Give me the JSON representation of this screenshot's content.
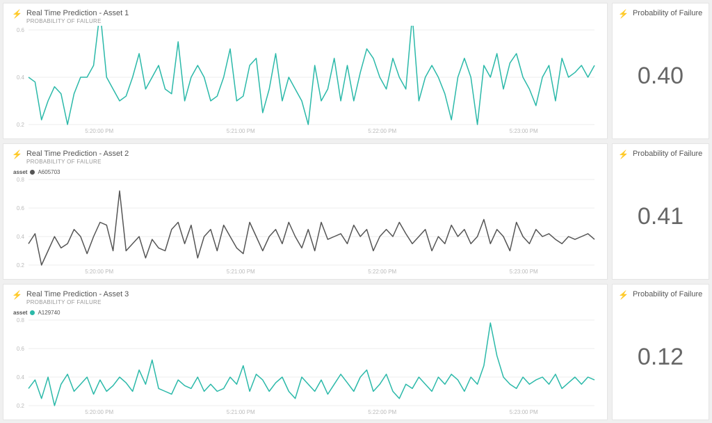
{
  "ticks_x_labels": [
    "5:20:00 PM",
    "5:21:00 PM",
    "5:22:00 PM",
    "5:23:00 PM"
  ],
  "rows": [
    {
      "chart_title": "Real Time Prediction - Asset 1",
      "chart_subtitle": "PROBABILITY OF FAILURE",
      "value_title": "Probability of Failure",
      "value": "0.40",
      "legend": null,
      "color": "#2bb9a9"
    },
    {
      "chart_title": "Real Time Prediction - Asset 2",
      "chart_subtitle": "PROBABILITY OF FAILURE",
      "value_title": "Probability of Failure",
      "value": "0.41",
      "legend": {
        "key": "asset",
        "label": "A605703",
        "color": "#555555"
      },
      "color": "#555555"
    },
    {
      "chart_title": "Real Time Prediction - Asset 3",
      "chart_subtitle": "PROBABILITY OF FAILURE",
      "value_title": "Probability of Failure",
      "value": "0.12",
      "legend": {
        "key": "asset",
        "label": "A129740",
        "color": "#2bb9a9"
      },
      "color": "#2bb9a9"
    }
  ],
  "chart_data": [
    {
      "type": "line",
      "title": "Real Time Prediction - Asset 1",
      "xlabel": "",
      "ylabel": "",
      "ylim": [
        0.2,
        0.6
      ],
      "y_ticks": [
        0.2,
        0.4,
        0.6
      ],
      "x_tick_labels": [
        "5:20:00 PM",
        "5:21:00 PM",
        "5:22:00 PM",
        "5:23:00 PM"
      ],
      "series": [
        {
          "name": "Asset 1",
          "color": "#2bb9a9",
          "values": [
            0.4,
            0.38,
            0.22,
            0.3,
            0.36,
            0.33,
            0.2,
            0.33,
            0.4,
            0.4,
            0.45,
            0.68,
            0.4,
            0.35,
            0.3,
            0.32,
            0.4,
            0.5,
            0.35,
            0.4,
            0.45,
            0.35,
            0.33,
            0.55,
            0.3,
            0.4,
            0.45,
            0.4,
            0.3,
            0.32,
            0.4,
            0.52,
            0.3,
            0.32,
            0.45,
            0.48,
            0.25,
            0.35,
            0.5,
            0.3,
            0.4,
            0.35,
            0.3,
            0.2,
            0.45,
            0.3,
            0.35,
            0.48,
            0.3,
            0.45,
            0.3,
            0.42,
            0.52,
            0.48,
            0.4,
            0.35,
            0.48,
            0.4,
            0.35,
            0.66,
            0.3,
            0.4,
            0.45,
            0.4,
            0.33,
            0.22,
            0.4,
            0.48,
            0.4,
            0.2,
            0.45,
            0.4,
            0.5,
            0.35,
            0.46,
            0.5,
            0.4,
            0.35,
            0.28,
            0.4,
            0.45,
            0.3,
            0.48,
            0.4,
            0.42,
            0.45,
            0.4,
            0.45
          ]
        }
      ]
    },
    {
      "type": "line",
      "title": "Real Time Prediction - Asset 2",
      "xlabel": "",
      "ylabel": "",
      "ylim": [
        0.2,
        0.8
      ],
      "y_ticks": [
        0.2,
        0.4,
        0.6,
        0.8
      ],
      "x_tick_labels": [
        "5:20:00 PM",
        "5:21:00 PM",
        "5:22:00 PM",
        "5:23:00 PM"
      ],
      "series": [
        {
          "name": "A605703",
          "color": "#555555",
          "values": [
            0.35,
            0.42,
            0.2,
            0.3,
            0.4,
            0.32,
            0.35,
            0.45,
            0.4,
            0.28,
            0.4,
            0.5,
            0.48,
            0.3,
            0.72,
            0.3,
            0.35,
            0.4,
            0.25,
            0.38,
            0.32,
            0.3,
            0.45,
            0.5,
            0.35,
            0.48,
            0.25,
            0.4,
            0.45,
            0.3,
            0.48,
            0.4,
            0.32,
            0.28,
            0.5,
            0.4,
            0.3,
            0.4,
            0.45,
            0.35,
            0.5,
            0.4,
            0.32,
            0.45,
            0.3,
            0.5,
            0.38,
            0.4,
            0.42,
            0.35,
            0.48,
            0.4,
            0.45,
            0.3,
            0.4,
            0.45,
            0.4,
            0.5,
            0.42,
            0.35,
            0.4,
            0.45,
            0.3,
            0.4,
            0.35,
            0.48,
            0.4,
            0.45,
            0.35,
            0.4,
            0.52,
            0.35,
            0.45,
            0.4,
            0.3,
            0.5,
            0.4,
            0.35,
            0.45,
            0.4,
            0.42,
            0.38,
            0.35,
            0.4,
            0.38,
            0.4,
            0.42,
            0.38
          ]
        }
      ]
    },
    {
      "type": "line",
      "title": "Real Time Prediction - Asset 3",
      "xlabel": "",
      "ylabel": "",
      "ylim": [
        0.2,
        0.8
      ],
      "y_ticks": [
        0.2,
        0.4,
        0.6,
        0.8
      ],
      "x_tick_labels": [
        "5:20:00 PM",
        "5:21:00 PM",
        "5:22:00 PM",
        "5:23:00 PM"
      ],
      "series": [
        {
          "name": "A129740",
          "color": "#2bb9a9",
          "values": [
            0.32,
            0.38,
            0.25,
            0.4,
            0.2,
            0.35,
            0.42,
            0.3,
            0.35,
            0.4,
            0.28,
            0.38,
            0.3,
            0.34,
            0.4,
            0.36,
            0.3,
            0.45,
            0.35,
            0.52,
            0.32,
            0.3,
            0.28,
            0.38,
            0.34,
            0.32,
            0.4,
            0.3,
            0.35,
            0.3,
            0.32,
            0.4,
            0.35,
            0.48,
            0.3,
            0.42,
            0.38,
            0.3,
            0.36,
            0.4,
            0.3,
            0.25,
            0.4,
            0.35,
            0.3,
            0.38,
            0.28,
            0.35,
            0.42,
            0.36,
            0.3,
            0.4,
            0.45,
            0.3,
            0.35,
            0.42,
            0.3,
            0.25,
            0.35,
            0.32,
            0.4,
            0.35,
            0.3,
            0.4,
            0.35,
            0.42,
            0.38,
            0.3,
            0.4,
            0.35,
            0.48,
            0.78,
            0.55,
            0.4,
            0.35,
            0.32,
            0.4,
            0.35,
            0.38,
            0.4,
            0.35,
            0.42,
            0.32,
            0.36,
            0.4,
            0.35,
            0.4,
            0.38
          ]
        }
      ]
    }
  ]
}
